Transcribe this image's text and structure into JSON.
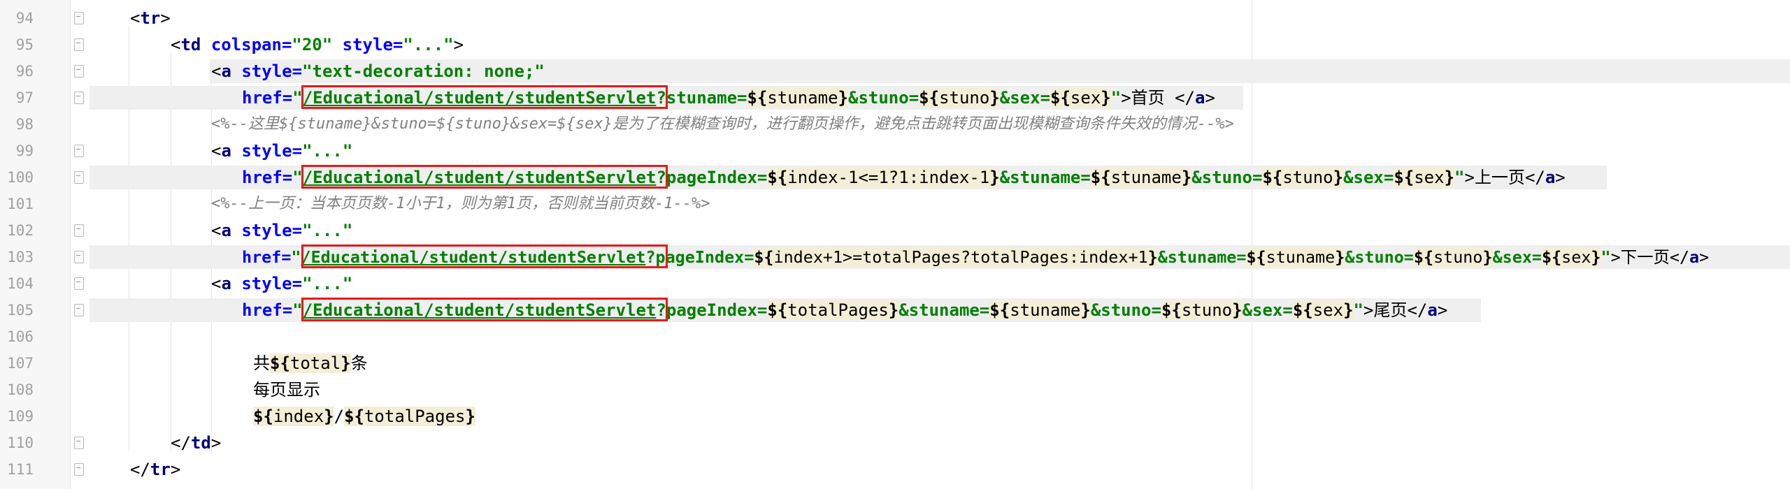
{
  "editor": {
    "line_numbers": [
      "94",
      "95",
      "96",
      "97",
      "98",
      "99",
      "100",
      "101",
      "102",
      "103",
      "104",
      "105",
      "106",
      "107",
      "108",
      "109",
      "110",
      "111"
    ],
    "lines": {
      "l94": [
        "<",
        "tr",
        ">"
      ],
      "l95": [
        "<",
        "td ",
        "colspan=",
        "\"20\" ",
        "style=",
        "\"...\"",
        ">"
      ],
      "l96": [
        "<",
        "a ",
        "style=",
        "\"text-decoration: none;\""
      ],
      "l97": [
        "href=",
        "\"",
        "/Educational/student/studentServlet",
        "?stuname=",
        "${",
        "stuname",
        "}",
        "&stuno=",
        "${",
        "stuno",
        "}",
        "&sex=",
        "${",
        "sex",
        "}",
        "\"",
        ">",
        "首页 ",
        "</",
        "a",
        ">"
      ],
      "l98": [
        "<%--这里",
        "${stuname}&stuno=${stuno}&sex=${sex}",
        "是为了在模糊查询时，进行翻页操作，避免点击跳转页面出现模糊查询条件失效的情况",
        "--%>"
      ],
      "l99": [
        "<",
        "a ",
        "style=",
        "\"...\""
      ],
      "l100": [
        "href=",
        "\"",
        "/Educational/student/studentServlet",
        "?pageIndex=",
        "${",
        "index-1<=1?1:index-1",
        "}",
        "&stuname=",
        "${",
        "stuname",
        "}",
        "&stuno=",
        "${",
        "stuno",
        "}",
        "&sex=",
        "${",
        "sex",
        "}",
        "\"",
        ">",
        "上一页",
        "</",
        "a",
        ">"
      ],
      "l101": [
        "<%--上一页：当本页页数",
        "-1",
        "小于",
        "1",
        "，则为第",
        "1",
        "页，否则就当前页数",
        "-1",
        "--%>"
      ],
      "l102": [
        "<",
        "a ",
        "style=",
        "\"...\""
      ],
      "l103": [
        "href=",
        "\"",
        "/Educational/student/studentServlet",
        "?pageIndex=",
        "${",
        "index+1>=totalPages?totalPages:index+1",
        "}",
        "&stuname=",
        "${",
        "stuname",
        "}",
        "&stuno=",
        "${",
        "stuno",
        "}",
        "&sex=",
        "${",
        "sex",
        "}",
        "\"",
        ">",
        "下一页",
        "</",
        "a",
        ">"
      ],
      "l104": [
        "<",
        "a ",
        "style=",
        "\"...\""
      ],
      "l105": [
        "href=",
        "\"",
        "/Educational/student/studentServlet",
        "?pageIndex=",
        "${",
        "totalPages",
        "}",
        "&stuname=",
        "${",
        "stuname",
        "}",
        "&stuno=",
        "${",
        "stuno",
        "}",
        "&sex=",
        "${",
        "sex",
        "}",
        "\"",
        ">",
        "尾页",
        "</",
        "a",
        ">"
      ],
      "l107": [
        "共",
        "${",
        "total",
        "}",
        "条"
      ],
      "l108": [
        "每页显示"
      ],
      "l109": [
        "${",
        "index",
        "}",
        "/",
        "${",
        "totalPages",
        "}"
      ],
      "l110": [
        "</",
        "td",
        ">"
      ],
      "l111": [
        "</",
        "tr",
        ">"
      ]
    },
    "highlight_color": "#e21b1b",
    "colors": {
      "tag": "#000080",
      "attribute": "#0000ff",
      "string": "#008000",
      "comment": "#808080",
      "el_background": "#f5eed6"
    }
  }
}
